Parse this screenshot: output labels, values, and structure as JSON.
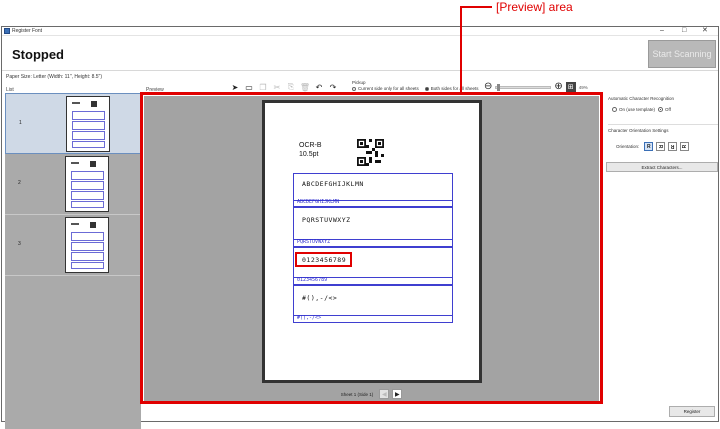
{
  "window": {
    "title": "Register Font",
    "min": "–",
    "max": "□",
    "close": "✕"
  },
  "status": "Stopped",
  "start_button": "Start Scanning",
  "paper_size": "Paper Size:  Letter  (Width: 11\", Height: 8.5\")",
  "list_label": "List",
  "preview_label": "Preview",
  "pickup": {
    "label": "Pickup",
    "opt1": "Current side only for all sheets",
    "opt2": "Both sides for all sheets",
    "selected": "opt2"
  },
  "zoom": {
    "percent": "49%",
    "out_icon": "⊖",
    "in_icon": "⊕",
    "fit_icon": "⊞"
  },
  "sheets": [
    {
      "num": "1",
      "selected": true
    },
    {
      "num": "2",
      "selected": false
    },
    {
      "num": "3",
      "selected": false
    }
  ],
  "page": {
    "font_name": "OCR-B",
    "font_size": "10.5pt",
    "rows": [
      {
        "big": "ABCDEFGHIJKLMN",
        "small": "ABCDEFGHIJKLMN"
      },
      {
        "big": "PQRSTUVWXYZ",
        "small": "PQRSTUVWXYZ"
      },
      {
        "big": "0123456789",
        "small": "0123456789"
      },
      {
        "big": "#(),-/<>",
        "small": "#(),-/<>"
      }
    ]
  },
  "nav": {
    "label": "Sheet  1   (Side 1)",
    "prev": "◀",
    "next": "▶"
  },
  "annotation": {
    "text": "[Preview] area",
    "color": "#e00000"
  },
  "acr": {
    "title": "Automatic Character Recognition",
    "on_label": "On (use template)",
    "off_label": "Off",
    "selected": "off"
  },
  "orientation": {
    "title": "Character Orientation Settings",
    "label": "Orientation:",
    "buttons": [
      "R",
      "R",
      "R",
      "R"
    ]
  },
  "extract_button": "Extract Characters...",
  "register_button": "Register",
  "colors": {
    "accent": "#3a6fb6",
    "red": "#e00000",
    "grid_blue": "#3f3fd0"
  }
}
